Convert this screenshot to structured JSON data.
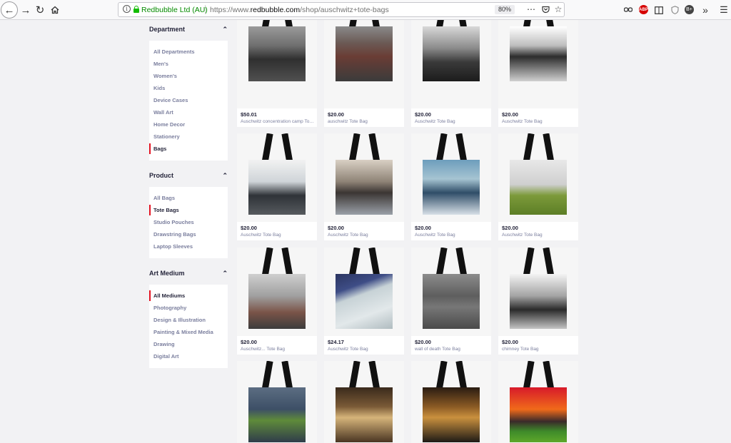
{
  "browser": {
    "site_identity": "Redbubble Ltd (AU)",
    "url_prefix": "https://www.",
    "url_domain": "redbubble.com",
    "url_path": "/shop/auschwitz+tote-bags",
    "zoom": "80%"
  },
  "sidebar": {
    "department": {
      "heading": "Department",
      "items": [
        "All Departments",
        "Men's",
        "Women's",
        "Kids",
        "Device Cases",
        "Wall Art",
        "Home Decor",
        "Stationery",
        "Bags"
      ],
      "active_index": 8
    },
    "product": {
      "heading": "Product",
      "items": [
        "All Bags",
        "Tote Bags",
        "Studio Pouches",
        "Drawstring Bags",
        "Laptop Sleeves"
      ],
      "active_index": 1
    },
    "art_medium": {
      "heading": "Art Medium",
      "items": [
        "All Mediums",
        "Photography",
        "Design & Illustration",
        "Painting & Mixed Media",
        "Drawing",
        "Digital Art"
      ],
      "active_index": 0
    }
  },
  "products": [
    {
      "price": "$50.01",
      "title": "Auschwitz concentration camp Tote Bag",
      "art": "rail-bw"
    },
    {
      "price": "$20.00",
      "title": "auschwitz Tote Bag",
      "art": "barracks-brick"
    },
    {
      "price": "$20.00",
      "title": "Auschwitz Tote Bag",
      "art": "rail-bw-2"
    },
    {
      "price": "$20.00",
      "title": "Auschwitz Tote Bag",
      "art": "building-bw"
    },
    {
      "price": "$20.00",
      "title": "Auschwitz Tote Bag",
      "art": "fence-fog"
    },
    {
      "price": "$20.00",
      "title": "Auschwitz Tote Bag",
      "art": "gate-reflection"
    },
    {
      "price": "$20.00",
      "title": "Auschwitz Tote Bag",
      "art": "gate-snow"
    },
    {
      "price": "$20.00",
      "title": "Auschwitz Tote Bag",
      "art": "watchtower"
    },
    {
      "price": "$20.00",
      "title": "Auschwitz... Tote Bag",
      "art": "fence-posts"
    },
    {
      "price": "$24.17",
      "title": "Auschwitz Tote Bag",
      "art": "paper-blue"
    },
    {
      "price": "$20.00",
      "title": "wall of death Tote Bag",
      "art": "stone-wall"
    },
    {
      "price": "$20.00",
      "title": "chimney Tote Bag",
      "art": "chimney"
    },
    {
      "price": "",
      "title": "",
      "art": "gate-green"
    },
    {
      "price": "",
      "title": "",
      "art": "window-room"
    },
    {
      "price": "",
      "title": "",
      "art": "oven-room"
    },
    {
      "price": "",
      "title": "",
      "art": "sunset-fence"
    }
  ]
}
